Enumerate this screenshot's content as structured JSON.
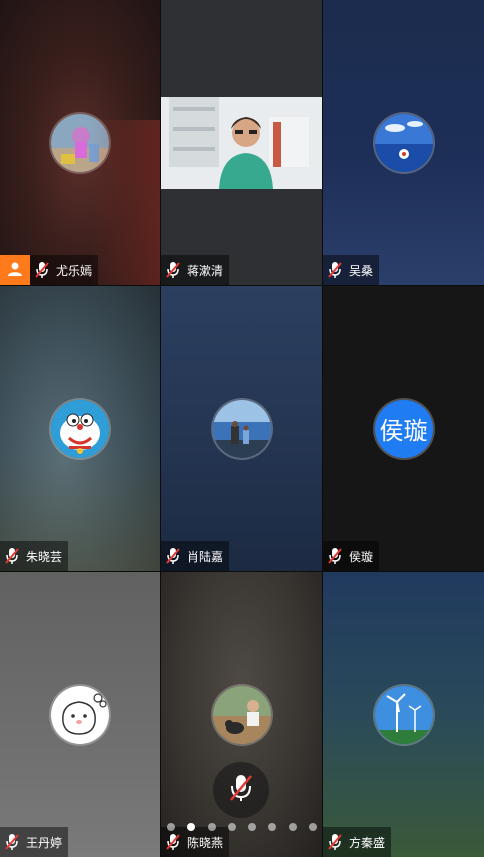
{
  "participants": [
    {
      "name": "尤乐嫣",
      "host": true,
      "muted": true
    },
    {
      "name": "蒋漱清",
      "host": false,
      "muted": true,
      "video_on": true
    },
    {
      "name": "吴桑",
      "host": false,
      "muted": true
    },
    {
      "name": "朱晓芸",
      "host": false,
      "muted": true
    },
    {
      "name": "肖陆嘉",
      "host": false,
      "muted": true
    },
    {
      "name": "侯璇",
      "host": false,
      "muted": true,
      "initials": "侯璇"
    },
    {
      "name": "王丹婷",
      "host": false,
      "muted": true
    },
    {
      "name": "陈晓燕",
      "host": false,
      "muted": true
    },
    {
      "name": "方秦盛",
      "host": false,
      "muted": true
    }
  ],
  "pager": {
    "pages": 8,
    "active_index": 1
  },
  "colors": {
    "host_badge": "#ff7a1a",
    "initial_avatar": "#1f7cf2",
    "mute_slash": "#e53935"
  }
}
